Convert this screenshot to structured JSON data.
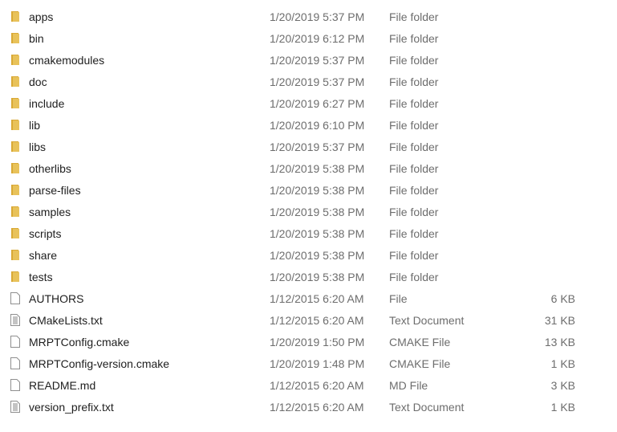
{
  "colors": {
    "folder": "#e8c25a",
    "folder_dark": "#d9a936",
    "text": "#1e1e1e",
    "muted": "#6d6d6d"
  },
  "files": [
    {
      "name": "apps",
      "date": "1/20/2019 5:37 PM",
      "type": "File folder",
      "size": "",
      "icon": "folder-icon"
    },
    {
      "name": "bin",
      "date": "1/20/2019 6:12 PM",
      "type": "File folder",
      "size": "",
      "icon": "folder-icon"
    },
    {
      "name": "cmakemodules",
      "date": "1/20/2019 5:37 PM",
      "type": "File folder",
      "size": "",
      "icon": "folder-icon"
    },
    {
      "name": "doc",
      "date": "1/20/2019 5:37 PM",
      "type": "File folder",
      "size": "",
      "icon": "folder-icon"
    },
    {
      "name": "include",
      "date": "1/20/2019 6:27 PM",
      "type": "File folder",
      "size": "",
      "icon": "folder-icon"
    },
    {
      "name": "lib",
      "date": "1/20/2019 6:10 PM",
      "type": "File folder",
      "size": "",
      "icon": "folder-icon"
    },
    {
      "name": "libs",
      "date": "1/20/2019 5:37 PM",
      "type": "File folder",
      "size": "",
      "icon": "folder-icon"
    },
    {
      "name": "otherlibs",
      "date": "1/20/2019 5:38 PM",
      "type": "File folder",
      "size": "",
      "icon": "folder-icon"
    },
    {
      "name": "parse-files",
      "date": "1/20/2019 5:38 PM",
      "type": "File folder",
      "size": "",
      "icon": "folder-icon"
    },
    {
      "name": "samples",
      "date": "1/20/2019 5:38 PM",
      "type": "File folder",
      "size": "",
      "icon": "folder-icon"
    },
    {
      "name": "scripts",
      "date": "1/20/2019 5:38 PM",
      "type": "File folder",
      "size": "",
      "icon": "folder-icon"
    },
    {
      "name": "share",
      "date": "1/20/2019 5:38 PM",
      "type": "File folder",
      "size": "",
      "icon": "folder-icon"
    },
    {
      "name": "tests",
      "date": "1/20/2019 5:38 PM",
      "type": "File folder",
      "size": "",
      "icon": "folder-icon"
    },
    {
      "name": "AUTHORS",
      "date": "1/12/2015 6:20 AM",
      "type": "File",
      "size": "6 KB",
      "icon": "file-icon"
    },
    {
      "name": "CMakeLists.txt",
      "date": "1/12/2015 6:20 AM",
      "type": "Text Document",
      "size": "31 KB",
      "icon": "text-file-icon"
    },
    {
      "name": "MRPTConfig.cmake",
      "date": "1/20/2019 1:50 PM",
      "type": "CMAKE File",
      "size": "13 KB",
      "icon": "file-icon"
    },
    {
      "name": "MRPTConfig-version.cmake",
      "date": "1/20/2019 1:48 PM",
      "type": "CMAKE File",
      "size": "1 KB",
      "icon": "file-icon"
    },
    {
      "name": "README.md",
      "date": "1/12/2015 6:20 AM",
      "type": "MD File",
      "size": "3 KB",
      "icon": "file-icon"
    },
    {
      "name": "version_prefix.txt",
      "date": "1/12/2015 6:20 AM",
      "type": "Text Document",
      "size": "1 KB",
      "icon": "text-file-icon"
    }
  ]
}
